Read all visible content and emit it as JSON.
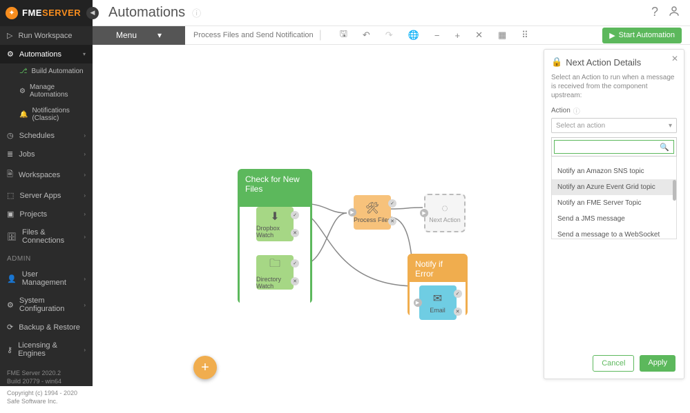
{
  "page_title": "Automations",
  "logo": {
    "text_left": "FME",
    "text_right": "SERVER"
  },
  "topbar_icons": {
    "help": "help-icon",
    "user": "user-icon"
  },
  "sidebar": {
    "items": [
      {
        "icon": "play-icon",
        "label": "Run Workspace"
      }
    ],
    "automations": {
      "label": "Automations",
      "children": [
        {
          "icon": "branch-icon",
          "label": "Build Automation"
        },
        {
          "icon": "gear-icon",
          "label": "Manage Automations"
        },
        {
          "icon": "bell-icon",
          "label": "Notifications (Classic)"
        }
      ]
    },
    "rest": [
      {
        "icon": "clock-icon",
        "label": "Schedules"
      },
      {
        "icon": "list-icon",
        "label": "Jobs"
      },
      {
        "icon": "doc-icon",
        "label": "Workspaces"
      },
      {
        "icon": "apps-icon",
        "label": "Server Apps"
      },
      {
        "icon": "folder-icon",
        "label": "Projects"
      },
      {
        "icon": "db-icon",
        "label": "Files & Connections"
      }
    ],
    "admin_label": "ADMIN",
    "admin": [
      {
        "icon": "user-icon",
        "label": "User Management"
      },
      {
        "icon": "gear-icon",
        "label": "System Configuration"
      },
      {
        "icon": "backup-icon",
        "label": "Backup & Restore"
      },
      {
        "icon": "key-icon",
        "label": "Licensing & Engines"
      }
    ],
    "footer": {
      "line1": "FME Server 2020.2",
      "line2": "Build 20779 - win64",
      "line3": "Copyright (c) 1994 - 2020",
      "line4": "Safe Software Inc."
    }
  },
  "toolbar": {
    "menu": "Menu",
    "filename": "Process Files and Send Notification",
    "start": "Start Automation"
  },
  "canvas": {
    "group_check": "Check for New Files",
    "group_notify": "Notify if Error",
    "nodes": {
      "dropbox": "Dropbox Watch",
      "directory": "Directory Watch",
      "process": "Process Files",
      "next": "Next Action",
      "email": "Email"
    }
  },
  "panel": {
    "title": "Next Action Details",
    "desc": "Select an Action to run when a message is received from the component upstream:",
    "action_label": "Action",
    "select_placeholder": "Select an action",
    "options": [
      "Notify an Amazon SNS topic",
      "Notify an Azure Event Grid topic",
      "Notify an FME Server Topic",
      "Send a JMS message",
      "Send a message to a WebSocket channel"
    ],
    "selected_index": 1,
    "cancel": "Cancel",
    "apply": "Apply"
  }
}
